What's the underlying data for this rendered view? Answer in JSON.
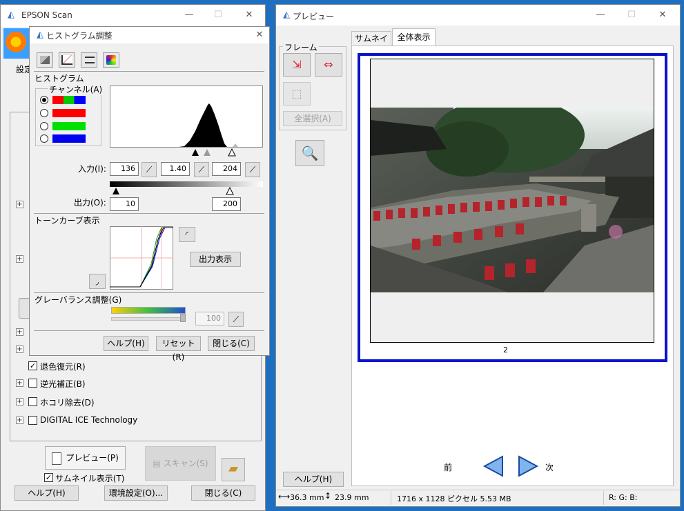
{
  "epson": {
    "title": "EPSON Scan",
    "settings_label": "設定",
    "items": {
      "restore": "退色復元(R)",
      "backlight": "逆光補正(B)",
      "dust": "ホコリ除去(D)",
      "ice": "DIGITAL ICE Technology"
    },
    "preview_btn": "プレビュー(P)",
    "scan_btn": "スキャン(S)",
    "thumbnail": "サムネイル表示(T)",
    "help": "ヘルプ(H)",
    "env": "環境設定(O)...",
    "close": "閉じる(C)"
  },
  "hist": {
    "title": "ヒストグラム調整",
    "section_hist": "ヒストグラム",
    "channel": "チャンネル(A)",
    "input_label": "入力(I):",
    "input_values": [
      "136",
      "1.40",
      "204"
    ],
    "output_label": "出力(O):",
    "output_values": [
      "10",
      "200"
    ],
    "section_tone": "トーンカーブ表示",
    "output_display": "出力表示",
    "section_gray": "グレーバランス調整(G)",
    "gray_value": "100",
    "help": "ヘルプ(H)",
    "reset": "リセット(R)",
    "close": "閉じる(C)"
  },
  "preview": {
    "title": "プレビュー",
    "tab_thumb": "サムネイル",
    "tab_full": "全体表示",
    "frame": "フレーム",
    "select_all": "全選択(A)",
    "frame_number": "2",
    "prev": "前",
    "next": "次",
    "help": "ヘルプ(H)",
    "status_width": "36.3 mm",
    "status_height": "23.9 mm",
    "status_size": "1716 x 1128 ピクセル 5.53 MB",
    "status_rgb": "R: G: B:"
  },
  "colors": {
    "desktop": "#1e6fc0",
    "frame_border": "#0a14c8",
    "accent_blue": "#2d6fd0"
  }
}
